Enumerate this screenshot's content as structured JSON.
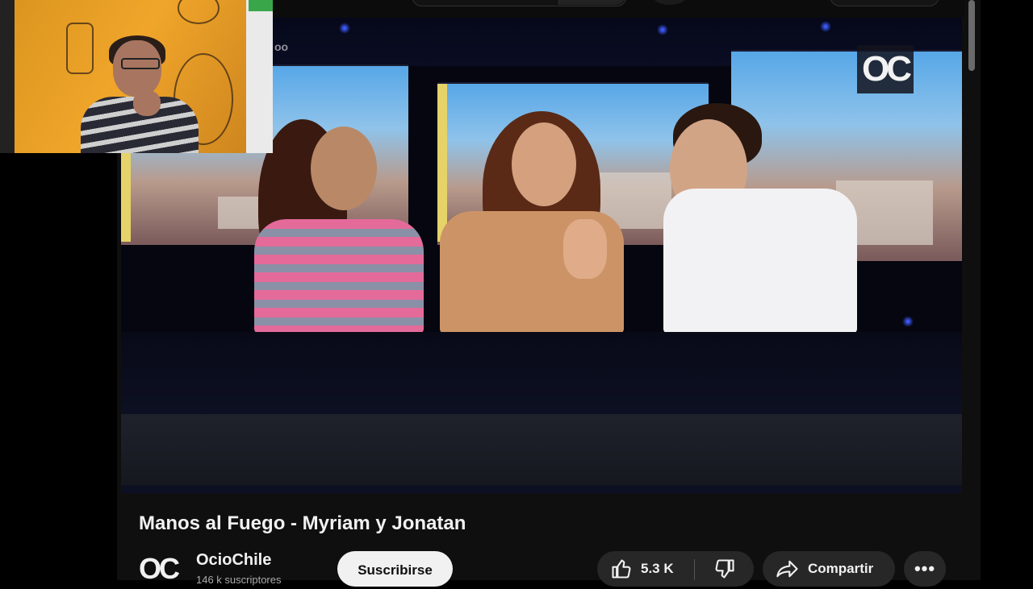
{
  "video": {
    "title": "Manos al Fuego - Myriam y Jonatan",
    "overlay_logo": "OC",
    "watermark_text": "oo"
  },
  "channel": {
    "avatar_text": "OC",
    "name": "OcioChile",
    "subscriber_text": "146 k suscriptores"
  },
  "actions": {
    "subscribe_label": "Suscribirse",
    "like_count": "5.3 K",
    "share_label": "Compartir",
    "more_label": "•••"
  },
  "icons": {
    "like": "thumbs-up-icon",
    "dislike": "thumbs-down-icon",
    "share": "share-arrow-icon",
    "more": "more-horizontal-icon"
  },
  "colors": {
    "background": "#0f0f0f",
    "text": "#f1f1f1",
    "pill": "#272727",
    "subscribe_bg": "#f1f1f1",
    "webcam_wall": "#f0a52a"
  }
}
